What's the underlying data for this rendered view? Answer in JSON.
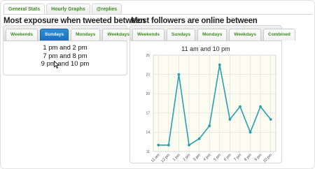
{
  "top_tabs": [
    {
      "label": "General Stats",
      "active": true
    },
    {
      "label": "Hourly Graphs",
      "active": false
    },
    {
      "label": "@replies",
      "active": false
    }
  ],
  "exposure": {
    "heading": "Most exposure when tweeted between",
    "tabs": [
      {
        "label": "Weekends",
        "selected": false
      },
      {
        "label": "Sundays",
        "selected": true
      },
      {
        "label": "Mondays",
        "selected": false
      },
      {
        "label": "Weekdays",
        "selected": false
      }
    ],
    "times": [
      "1 pm and 2 pm",
      "7 pm and 8 pm",
      "9 pm and 10 pm"
    ]
  },
  "followers": {
    "heading": "Most followers are online between",
    "tabs": [
      {
        "label": "Weekends",
        "selected": false
      },
      {
        "label": "Sundays",
        "selected": false
      },
      {
        "label": "Mondays",
        "selected": false
      },
      {
        "label": "Weekdays",
        "selected": false
      },
      {
        "label": "Combined",
        "selected": false
      }
    ]
  },
  "colors": {
    "tab_text": "#3c8a1f",
    "selected_tab": "#1f78c8",
    "line": "#2b9fb0",
    "plot_bg": "#fcfcf0",
    "grid": "#d9d9d9"
  },
  "chart_data": {
    "type": "line",
    "title": "11 am and 10 pm",
    "xlabel": "",
    "ylabel": "",
    "categories": [
      "11 am",
      "12 pm",
      "1 pm",
      "2 pm",
      "3 pm",
      "4 pm",
      "5 pm",
      "6 pm",
      "7 pm",
      "8 pm",
      "9 pm",
      "10 pm"
    ],
    "values": [
      12,
      12,
      23,
      12,
      13,
      15,
      24.5,
      16,
      18,
      14,
      18,
      16
    ],
    "ylim": [
      11,
      26
    ],
    "yticks": [
      11,
      14,
      17,
      20,
      23,
      26
    ],
    "grid": true,
    "legend": "none"
  }
}
